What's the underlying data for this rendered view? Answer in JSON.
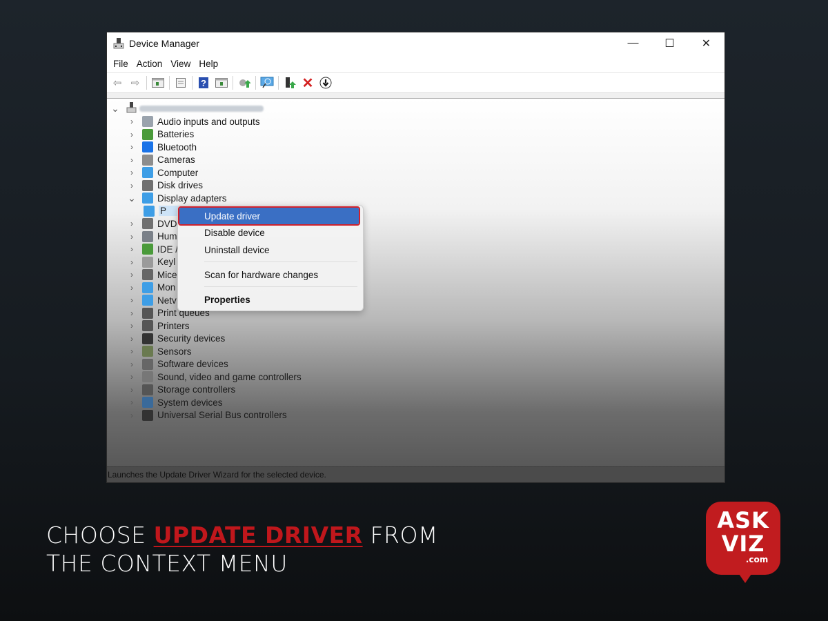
{
  "window": {
    "title": "Device Manager",
    "controls": {
      "minimize": "—",
      "maximize": "☐",
      "close": "✕"
    }
  },
  "menubar": [
    "File",
    "Action",
    "View",
    "Help"
  ],
  "toolbar": {
    "icons": [
      "back-icon",
      "forward-icon",
      "show-hide-console-tree-icon",
      "properties-icon",
      "help-icon",
      "action-pane-icon",
      "update-driver-icon",
      "scan-hardware-icon",
      "enable-device-icon",
      "uninstall-icon",
      "disable-device-icon"
    ]
  },
  "tree": {
    "root_chevron": "⌄",
    "items": [
      {
        "label": "Audio inputs and outputs",
        "color": "#9aa3ad"
      },
      {
        "label": "Batteries",
        "color": "#4a9a3a"
      },
      {
        "label": "Bluetooth",
        "color": "#1a73e8"
      },
      {
        "label": "Cameras",
        "color": "#8d8d8d"
      },
      {
        "label": "Computer",
        "color": "#3e9ee6"
      },
      {
        "label": "Disk drives",
        "color": "#707070"
      },
      {
        "label": "Display adapters",
        "color": "#3e9ee6",
        "expanded": true
      },
      {
        "label": "P",
        "color": "#3e9ee6",
        "child": true,
        "selected": true
      },
      {
        "label": "DVD",
        "color": "#707070"
      },
      {
        "label": "Hum",
        "color": "#7a8088"
      },
      {
        "label": "IDE /",
        "color": "#4a9a3a"
      },
      {
        "label": "Keyl",
        "color": "#9a9a9a"
      },
      {
        "label": "Mice",
        "color": "#666"
      },
      {
        "label": "Mon",
        "color": "#3e9ee6"
      },
      {
        "label": "Netv",
        "color": "#3e9ee6"
      },
      {
        "label": "Print queues",
        "color": "#555"
      },
      {
        "label": "Printers",
        "color": "#555"
      },
      {
        "label": "Security devices",
        "color": "#333"
      },
      {
        "label": "Sensors",
        "color": "#6a7a50"
      },
      {
        "label": "Software devices",
        "color": "#666"
      },
      {
        "label": "Sound, video and game controllers",
        "color": "#777"
      },
      {
        "label": "Storage controllers",
        "color": "#555"
      },
      {
        "label": "System devices",
        "color": "#3a6a9a"
      },
      {
        "label": "Universal Serial Bus controllers",
        "color": "#333"
      }
    ]
  },
  "context_menu": {
    "items": [
      {
        "label": "Update driver",
        "highlighted": true
      },
      {
        "label": "Disable device"
      },
      {
        "label": "Uninstall device"
      },
      {
        "label": "Scan for hardware changes"
      },
      {
        "label": "Properties",
        "bold": true
      }
    ]
  },
  "statusbar": {
    "text": "Launches the Update Driver Wizard for the selected device."
  },
  "caption": {
    "part1": "CHOOSE ",
    "highlight": "UPDATE DRIVER",
    "part2": " FROM",
    "line2": "THE CONTEXT MENU",
    "highlight_color": "#c0171c"
  },
  "logo": {
    "line1": "ASK",
    "line2": "VIZ",
    "line3": ".com",
    "color": "#c11c1f"
  }
}
